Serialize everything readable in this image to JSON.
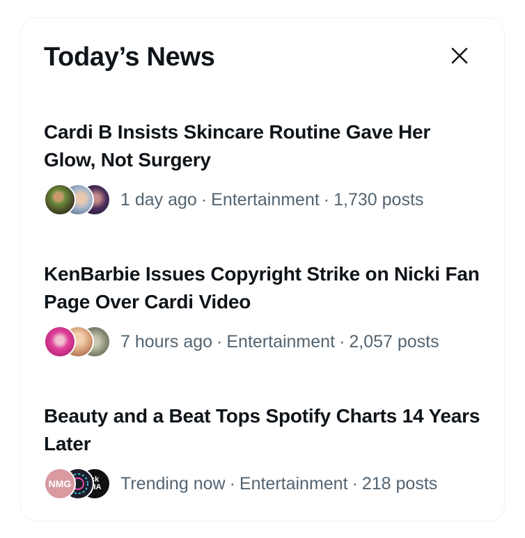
{
  "panel": {
    "title": "Today’s News",
    "close_icon": "close-icon"
  },
  "stories": [
    {
      "headline": "Cardi B Insists Skincare Routine Gave Her Glow, Not Surgery",
      "time": "1 day ago",
      "category": "Entertainment",
      "posts": "1,730 posts",
      "avatar_colors": [
        "#5a4a2a",
        "#8fa0b8",
        "#3a2d4e"
      ]
    },
    {
      "headline": "KenBarbie Issues Copyright Strike on Nicki Fan Page Over Cardi Video",
      "time": "7 hours ago",
      "category": "Entertainment",
      "posts": "2,057 posts",
      "avatar_colors": [
        "#e0409a",
        "#d8a27a",
        "#8b8f7a"
      ]
    },
    {
      "headline": "Beauty and a Beat Tops Spotify Charts 14 Years Later",
      "time": "Trending now",
      "category": "Entertainment",
      "posts": "218 posts",
      "avatar_colors": [
        "#d99aa0",
        "#1b1f2a",
        "#111111"
      ],
      "avatar_labels": [
        "NMG",
        "",
        "ck DIA"
      ]
    }
  ],
  "separator": "·",
  "colors": {
    "text_primary": "#0f1419",
    "text_secondary": "#536471",
    "border": "#eff3f4"
  }
}
